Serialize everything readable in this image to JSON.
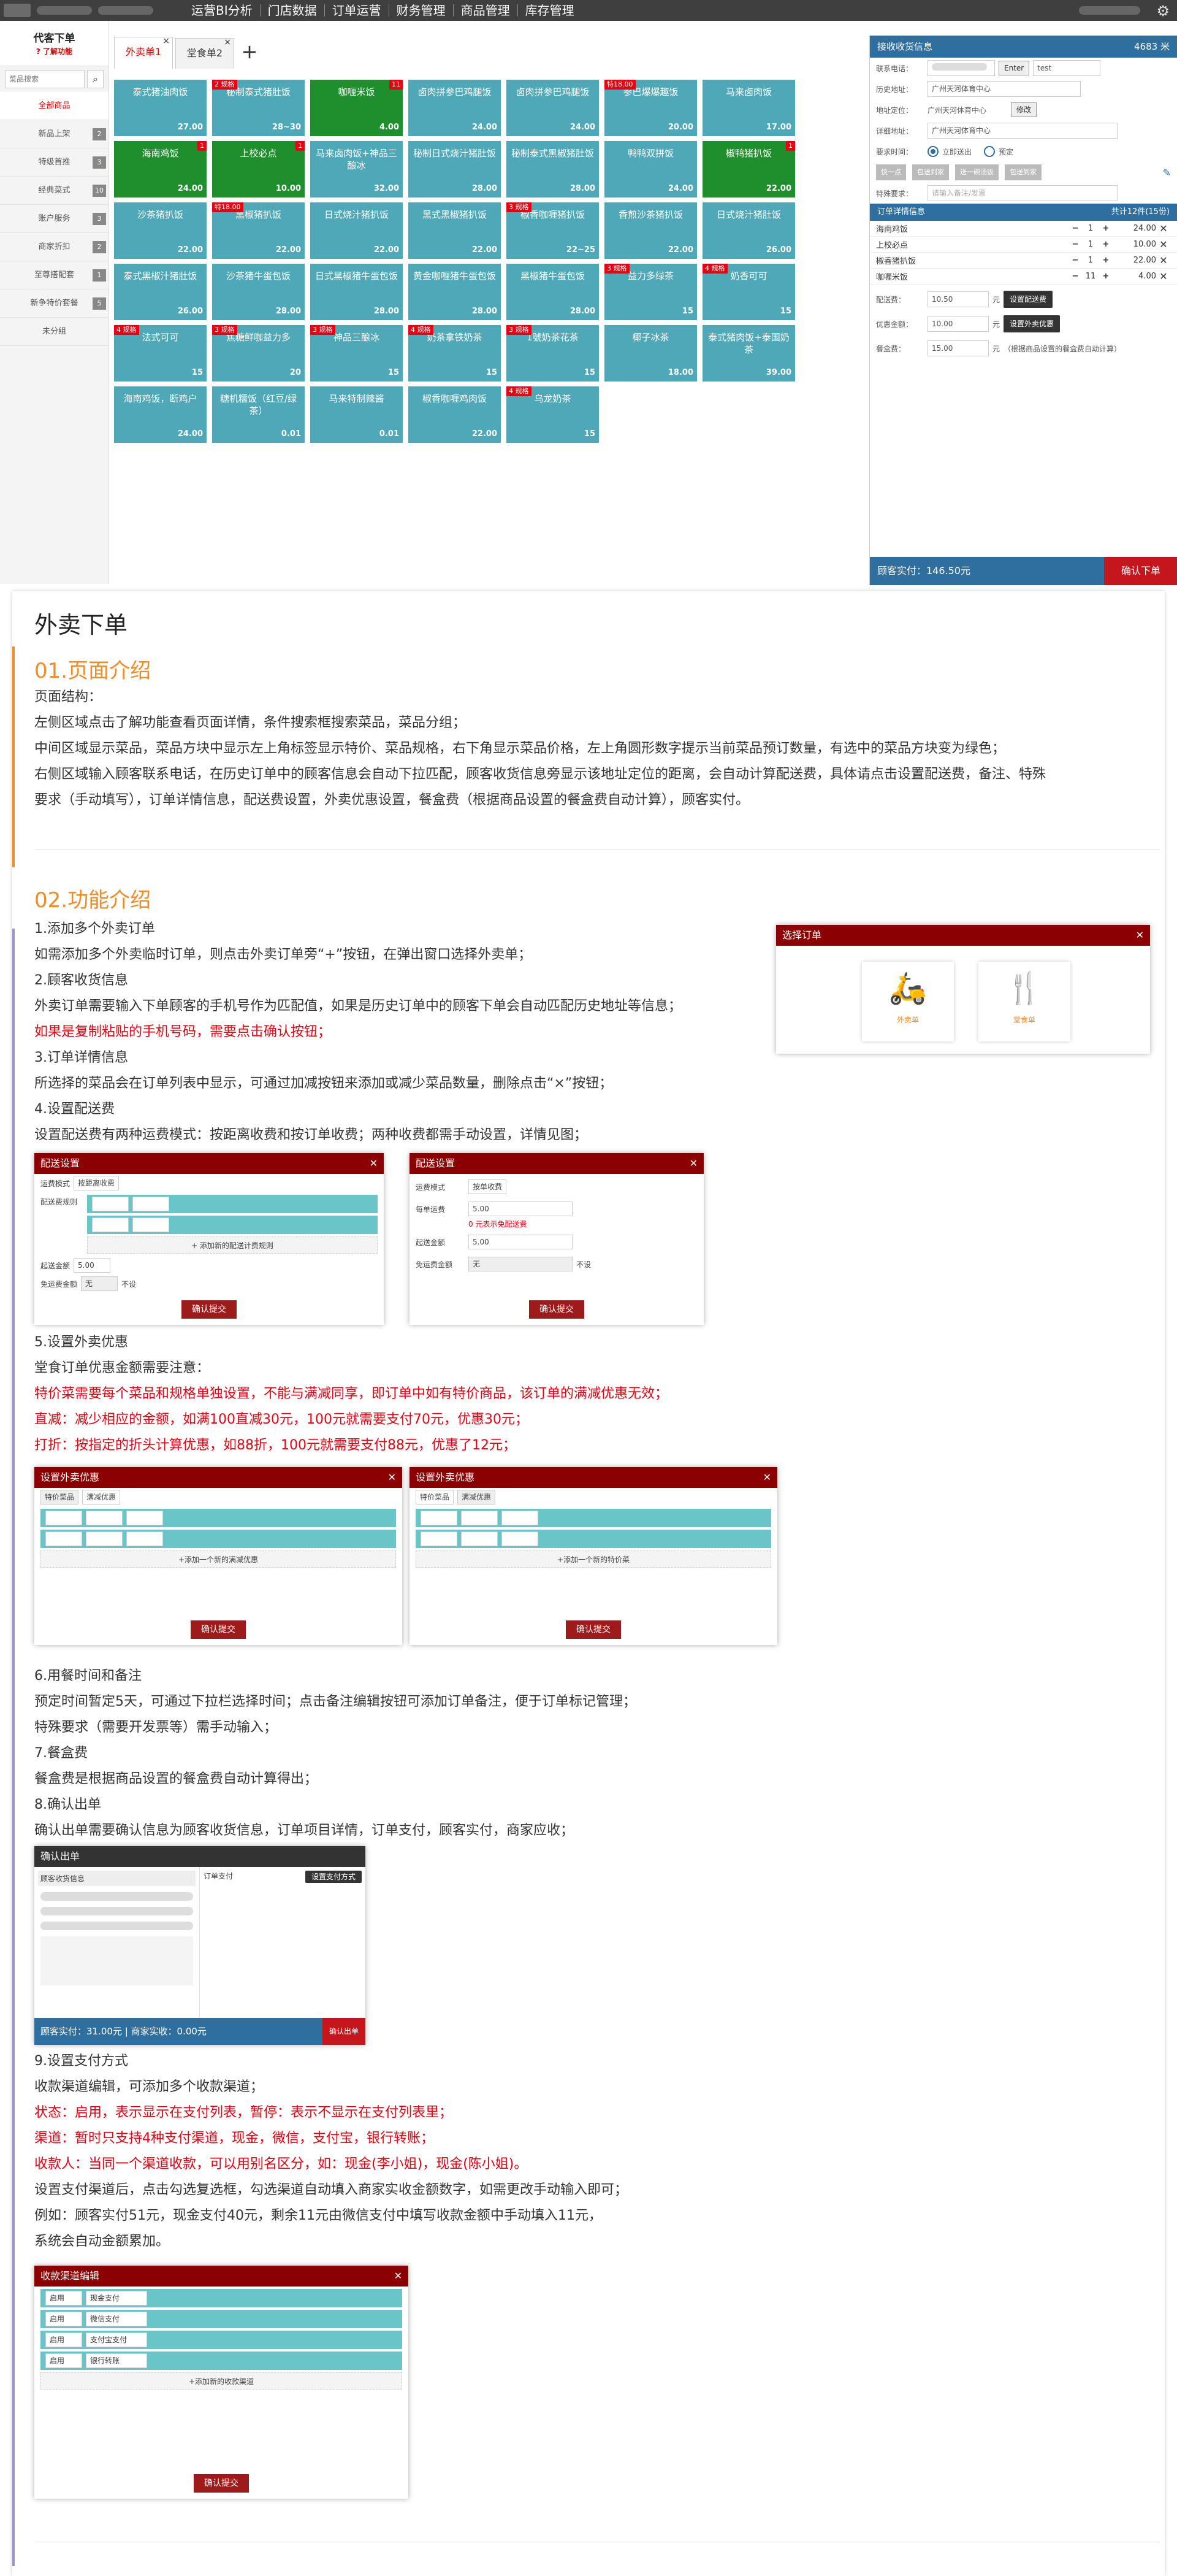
{
  "topbar": {
    "nav": [
      "运营BI分析",
      "门店数据",
      "订单运营",
      "财务管理",
      "商品管理",
      "库存管理"
    ]
  },
  "sidebar": {
    "title": "代客下单",
    "subtitle": "? 了解功能",
    "search_placeholder": "菜品搜索",
    "items": [
      {
        "label": "全部商品",
        "count": ""
      },
      {
        "label": "新品上架",
        "count": "2"
      },
      {
        "label": "特级首推",
        "count": "3"
      },
      {
        "label": "经典菜式",
        "count": "10"
      },
      {
        "label": "账户服务",
        "count": "3"
      },
      {
        "label": "商家折扣",
        "count": "2"
      },
      {
        "label": "至尊搭配套",
        "count": "1"
      },
      {
        "label": "新争特价套餐",
        "count": "5"
      },
      {
        "label": "未分组",
        "count": ""
      }
    ]
  },
  "tabs": [
    {
      "label": "外卖单1"
    },
    {
      "label": "堂食单2"
    }
  ],
  "tiles": [
    {
      "name": "泰式猪油肉饭",
      "price": "27.00",
      "color": "teal"
    },
    {
      "name": "秘制泰式猪肚饭",
      "price": "28~30",
      "color": "teal",
      "tag": "2 规格"
    },
    {
      "name": "咖喱米饭",
      "price": "4.00",
      "color": "green",
      "badge": "11"
    },
    {
      "name": "卤肉拼参巴鸡腿饭",
      "price": "24.00",
      "color": "teal"
    },
    {
      "name": "卤肉拼参巴鸡腿饭",
      "price": "24.00",
      "color": "teal"
    },
    {
      "name": "参巴爆爆趣饭",
      "price": "20.00",
      "color": "teal",
      "tag": "特18.00"
    },
    {
      "name": "马来卤肉饭",
      "price": "17.00",
      "color": "teal"
    },
    {
      "name": "海南鸡饭",
      "price": "24.00",
      "color": "green",
      "badge": "1"
    },
    {
      "name": "上校必点",
      "price": "10.00",
      "color": "green",
      "badge": "1"
    },
    {
      "name": "马来卤肉饭+神品三酿冰",
      "price": "32.00",
      "color": "teal"
    },
    {
      "name": "秘制日式烧汁猪肚饭",
      "price": "28.00",
      "color": "teal"
    },
    {
      "name": "秘制泰式黑椒猪肚饭",
      "price": "28.00",
      "color": "teal"
    },
    {
      "name": "鸭鸭双拼饭",
      "price": "24.00",
      "color": "teal"
    },
    {
      "name": "椒鸭猪扒饭",
      "price": "22.00",
      "color": "green",
      "badge": "1"
    },
    {
      "name": "沙茶猪扒饭",
      "price": "22.00",
      "color": "teal"
    },
    {
      "name": "黑椒猪扒饭",
      "price": "22.00",
      "color": "teal",
      "tag": "特18.00"
    },
    {
      "name": "日式烧汁猪扒饭",
      "price": "22.00",
      "color": "teal"
    },
    {
      "name": "黑式黑椒猪扒饭",
      "price": "22.00",
      "color": "teal"
    },
    {
      "name": "椒香咖喱猪扒饭",
      "price": "22~25",
      "color": "teal",
      "tag": "3 规格"
    },
    {
      "name": "香煎沙茶猪扒饭",
      "price": "22.00",
      "color": "teal"
    },
    {
      "name": "日式烧汁猪肚饭",
      "price": "26.00",
      "color": "teal"
    },
    {
      "name": "泰式黑椒汁猪肚饭",
      "price": "26.00",
      "color": "teal"
    },
    {
      "name": "沙茶猪牛蛋包饭",
      "price": "28.00",
      "color": "teal"
    },
    {
      "name": "日式黑椒猪牛蛋包饭",
      "price": "28.00",
      "color": "teal"
    },
    {
      "name": "黄金咖喱猪牛蛋包饭",
      "price": "28.00",
      "color": "teal"
    },
    {
      "name": "黑椒猪牛蛋包饭",
      "price": "28.00",
      "color": "teal"
    },
    {
      "name": "益力多绿茶",
      "price": "15",
      "color": "teal",
      "tag": "3 规格"
    },
    {
      "name": "奶香可可",
      "price": "15",
      "color": "teal",
      "tag": "4 规格"
    },
    {
      "name": "法式可可",
      "price": "15",
      "color": "teal",
      "tag": "4 规格"
    },
    {
      "name": "焦糖鲜咖益力多",
      "price": "20",
      "color": "teal",
      "tag": "3 规格"
    },
    {
      "name": "神品三酿冰",
      "price": "15",
      "color": "teal",
      "tag": "3 规格"
    },
    {
      "name": "奶茶拿铁奶茶",
      "price": "15",
      "color": "teal",
      "tag": "4 规格"
    },
    {
      "name": "1號奶茶花茶",
      "price": "15",
      "color": "teal",
      "tag": "3 规格"
    },
    {
      "name": "椰子冰茶",
      "price": "18.00",
      "color": "teal"
    },
    {
      "name": "泰式猪肉饭+泰国奶茶",
      "price": "39.00",
      "color": "teal"
    },
    {
      "name": "海南鸡饭，断鸡户",
      "price": "24.00",
      "color": "teal"
    },
    {
      "name": "糖机糯饭（红豆/绿茶）",
      "price": "0.01",
      "color": "teal"
    },
    {
      "name": "马来特制辣酱",
      "price": "0.01",
      "color": "teal"
    },
    {
      "name": "椒香咖喱鸡肉饭",
      "price": "22.00",
      "color": "teal"
    },
    {
      "name": "乌龙奶茶",
      "price": "15",
      "color": "teal",
      "tag": "4 规格"
    }
  ],
  "right": {
    "header": "接收收货信息",
    "distance": "4683 米",
    "phone_label": "联系电话：",
    "enter": "Enter",
    "contact": "test",
    "history_label": "历史地址：",
    "history_value": "广州天河体育中心",
    "addr_label": "地址定位：",
    "addr_value": "广州天河体育中心",
    "modify": "修改",
    "detail_label": "详细地址：",
    "detail_value": "广州天河体育中心",
    "time_label": "要求时间：",
    "time_now": "立即送出",
    "time_pre": "预定",
    "chips": [
      "快一点",
      "包送到家",
      "送一碗汤饭",
      "包送到家"
    ],
    "special_label": "特殊要求：",
    "special_placeholder": "请输入备注/发票",
    "order_header": "订单详情信息",
    "order_count": "共计12件(15份)",
    "items": [
      {
        "name": "海南鸡饭",
        "qty": "1",
        "price": "24.00"
      },
      {
        "name": "上校必点",
        "qty": "1",
        "price": "10.00"
      },
      {
        "name": "椒香猪扒饭",
        "qty": "1",
        "price": "22.00"
      },
      {
        "name": "咖喱米饭",
        "qty": "11",
        "price": "4.00"
      }
    ],
    "delivery_label": "配送费：",
    "delivery_value": "10.50",
    "delivery_btn": "设置配送费",
    "discount_label": "优惠金额：",
    "discount_value": "10.00",
    "discount_btn": "设置外卖优惠",
    "box_label": "餐盒费：",
    "box_value": "15.00",
    "box_note": "（根据商品设置的餐盒费自动计算）",
    "unit": "元",
    "total": "顾客实付：146.50元",
    "confirm": "确认下单"
  },
  "doc": {
    "title": "外卖下单",
    "s1": "01.页面介绍",
    "s1_lines": [
      "页面结构：",
      "左侧区域点击了解功能查看页面详情，条件搜索框搜索菜品，菜品分组；",
      "中间区域显示菜品，菜品方块中显示左上角标签显示特价、菜品规格，右下角显示菜品价格，左上角圆形数字提示当前菜品预订数量，有选中的菜品方块变为绿色；",
      "右侧区域输入顾客联系电话，在历史订单中的顾客信息会自动下拉匹配，顾客收货信息旁显示该地址定位的距离，会自动计算配送费，具体请点击设置配送费，备注、特殊",
      "要求（手动填写），订单详情信息，配送费设置，外卖优惠设置，餐盒费（根据商品设置的餐盒费自动计算），顾客实付。"
    ],
    "s2": "02.功能介绍",
    "f1": "1.添加多个外卖订单",
    "f1a": "如需添加多个外卖临时订单，则点击外卖订单旁“+”按钮，在弹出窗口选择外卖单；",
    "f2": "2.顾客收货信息",
    "f2a": "外卖订单需要输入下单顾客的手机号作为匹配值，如果是历史订单中的顾客下单会自动匹配历史地址等信息；",
    "f2b": "如果是复制粘贴的手机号码，需要点击确认按钮；",
    "f3": "3.订单详情信息",
    "f3a": "所选择的菜品会在订单列表中显示，可通过加减按钮来添加或减少菜品数量，删除点击“×”按钮；",
    "f4": "4.设置配送费",
    "f4a": "设置配送费有两种运费模式：按距离收费和按订单收费；两种收费都需手动设置，详情见图；",
    "f5": "5.设置外卖优惠",
    "f5a": "堂食订单优惠金额需要注意：",
    "f5b": "特价菜需要每个菜品和规格单独设置，不能与满减同享，即订单中如有特价商品，该订单的满减优惠无效；",
    "f5c": "直减：减少相应的金额，如满100直减30元，100元就需要支付70元，优惠30元；",
    "f5d": "打折：按指定的折头计算优惠，如88折，100元就需要支付88元，优惠了12元；",
    "f6": "6.用餐时间和备注",
    "f6a": "预定时间暂定5天，可通过下拉栏选择时间；点击备注编辑按钮可添加订单备注，便于订单标记管理；",
    "f6b": "特殊要求（需要开发票等）需手动输入；",
    "f7": "7.餐盒费",
    "f7a": "餐盒费是根据商品设置的餐盒费自动计算得出；",
    "f8": "8.确认出单",
    "f8a": "确认出单需要确认信息为顾客收货信息，订单项目详情，订单支付，顾客实付，商家应收；",
    "f9": "9.设置支付方式",
    "f9a": "收款渠道编辑，可添加多个收款渠道；",
    "f9b": "状态：启用，表示显示在支付列表，暂停：表示不显示在支付列表里；",
    "f9c": "渠道：暂时只支持4种支付渠道，现金，微信，支付宝，银行转账；",
    "f9d": "收款人：当同一个渠道收款，可以用别名区分，如：现金(李小姐)，现金(陈小姐)。",
    "f9e": "设置支付渠道后，点击勾选复选框，勾选渠道自动填入商家实收金额数字，如需更改手动输入即可；",
    "f9f": "例如：顾客实付51元，现金支付40元，剩余11元由微信支付中填写收款金额中手动填入11元，",
    "f9g": "系统会自动金额累加。"
  },
  "modals": {
    "select": {
      "title": "选择订单",
      "opt1": "外卖单",
      "opt2": "堂食单"
    },
    "ship1": {
      "title": "配送设置",
      "mode_label": "运费模式",
      "mode": "按距离收费",
      "fee_label": "配送费规则",
      "add": "+ 添加新的配送计费规则",
      "start_label": "起送金额",
      "start": "5.00",
      "free_label": "免运费金额",
      "free_ph": "无",
      "nolimit": "不设",
      "ok": "确认提交"
    },
    "ship2": {
      "title": "配送设置",
      "mode_label": "运费模式",
      "mode": "按单收费",
      "fee_label": "每单运费",
      "fee": "5.00",
      "fee_note": "0 元表示免配送费",
      "start_label": "起送金额",
      "start": "5.00",
      "free_label": "免运费金额",
      "free_ph": "无",
      "nolimit": "不设",
      "ok": "确认提交"
    },
    "disc1": {
      "title": "设置外卖优惠",
      "tab1": "特价菜品",
      "tab2": "满减优惠",
      "add": "+添加一个新的满减优惠",
      "ok": "确认提交"
    },
    "disc2": {
      "title": "设置外卖优惠",
      "tab1": "特价菜品",
      "tab2": "满减优惠",
      "add": "+添加一个新的特价菜",
      "ok": "确认提交"
    },
    "confirm": {
      "title": "确认出单",
      "left_title": "顾客收货信息",
      "right_title": "订单支付",
      "right_btn": "设置支付方式",
      "foot": "顾客实付：31.00元 | 商家实收：0.00元",
      "ok": "确认出单"
    },
    "pay": {
      "title": "收款渠道编辑",
      "add": "+添加新的收款渠道",
      "ok": "确认提交",
      "rows": [
        {
          "status": "启用",
          "channel": "现金支付"
        },
        {
          "status": "启用",
          "channel": "微信支付"
        },
        {
          "status": "启用",
          "channel": "支付宝支付"
        },
        {
          "status": "启用",
          "channel": "银行转账"
        }
      ]
    }
  },
  "colors": {
    "teal": "#4fa8b8",
    "green": "#1f8e2c",
    "accent": "#e60012",
    "brand": "#2f6f9f",
    "orange": "#f28c28"
  }
}
